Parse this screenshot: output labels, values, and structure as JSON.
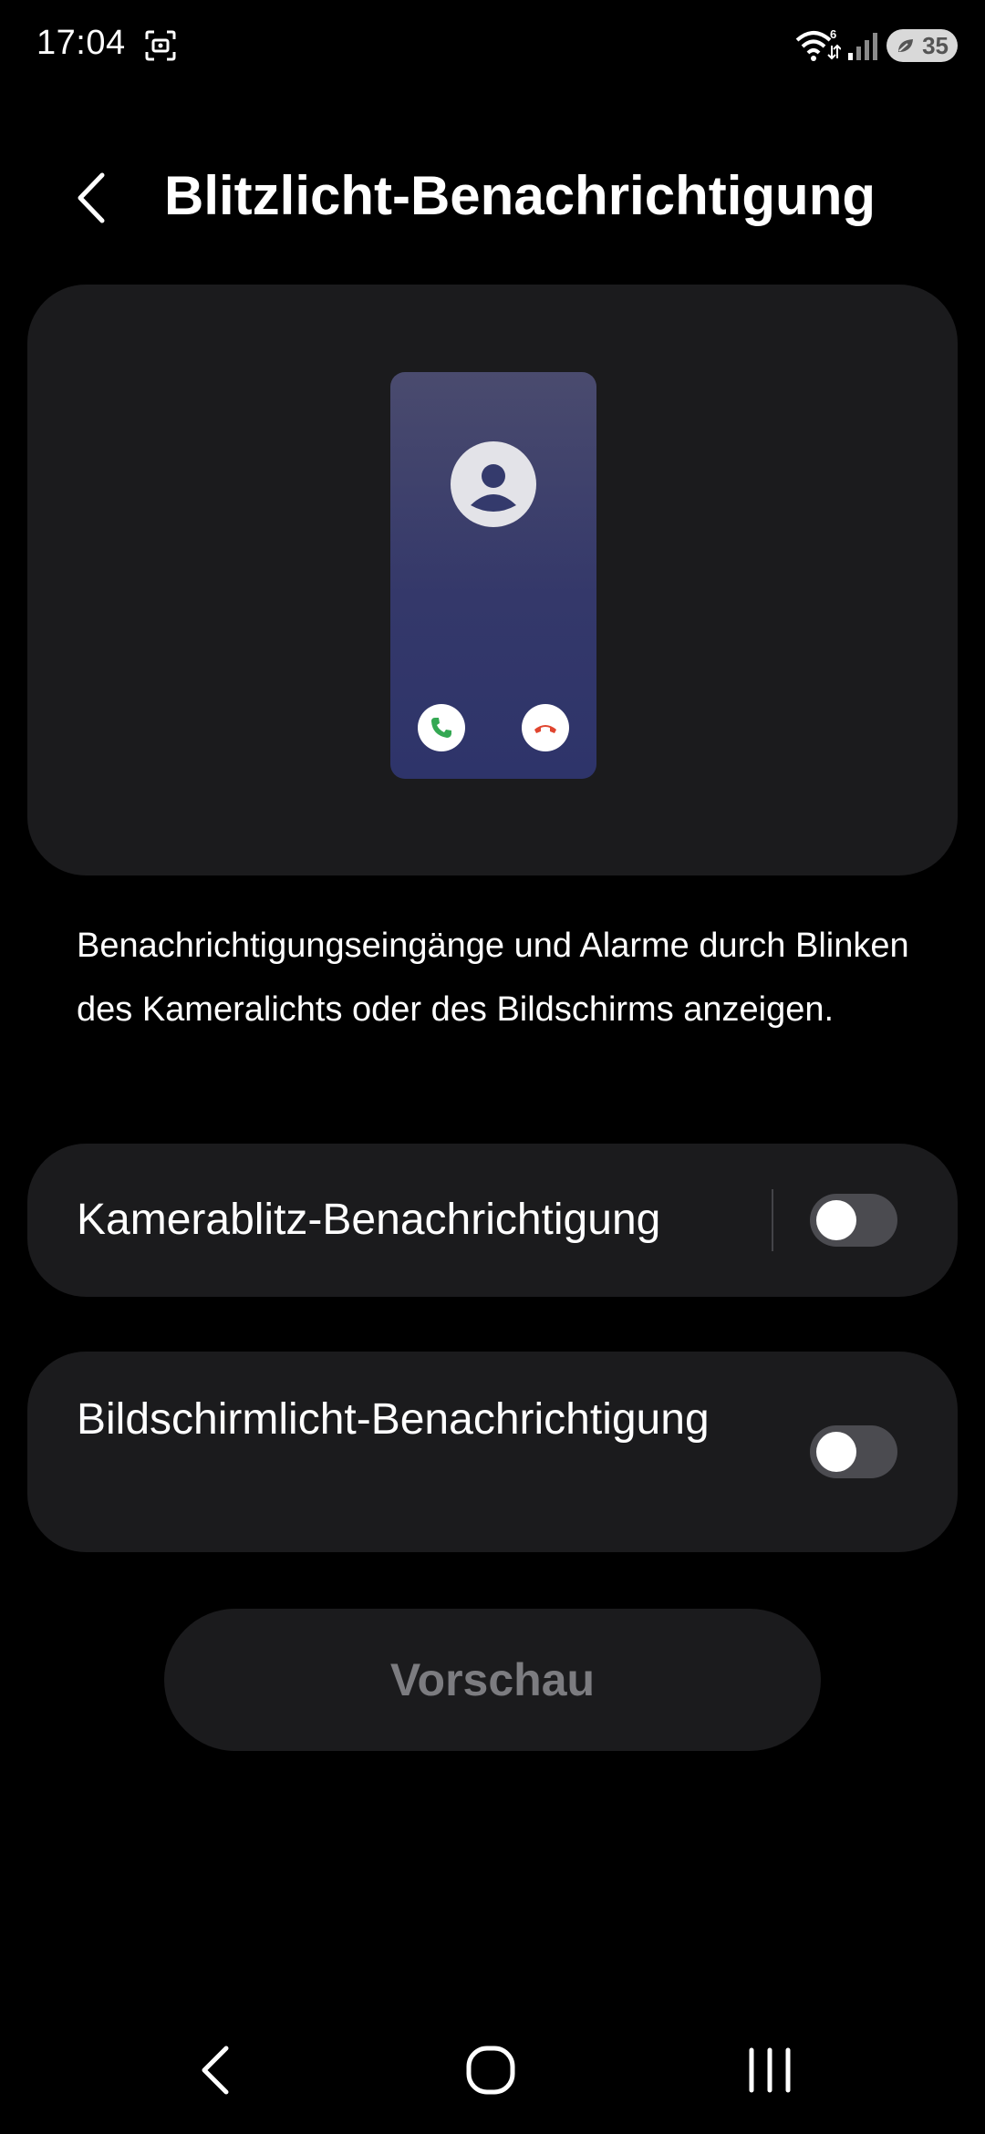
{
  "status_bar": {
    "time": "17:04",
    "battery_level": "35",
    "icons": [
      "screenshot-icon",
      "wifi-icon",
      "signal-icon",
      "battery-icon"
    ]
  },
  "header": {
    "title": "Blitzlicht-Benachrichtigung",
    "back_icon": "chevron-left-icon"
  },
  "illustration": {
    "icons": [
      "contact-avatar-icon",
      "accept-call-icon",
      "decline-call-icon"
    ],
    "accept_color": "#34a853",
    "decline_color": "#e0452f"
  },
  "description": "Benachrichtigungseingänge und Alarme durch Blinken des Kameralichts oder des Bildschirms anzeigen.",
  "settings": [
    {
      "label": "Kamerablitz-Benachrichtigung",
      "enabled": false
    },
    {
      "label": "Bildschirmlicht-Benachrichtigung",
      "enabled": false
    }
  ],
  "preview_button": {
    "label": "Vorschau",
    "enabled": false
  },
  "nav_bar": {
    "icons": [
      "nav-back-icon",
      "nav-home-icon",
      "nav-recents-icon"
    ]
  },
  "colors": {
    "background": "#000000",
    "card": "#1b1b1d",
    "switch_off": "#4b4b50",
    "disabled_text": "#7c7c80"
  }
}
